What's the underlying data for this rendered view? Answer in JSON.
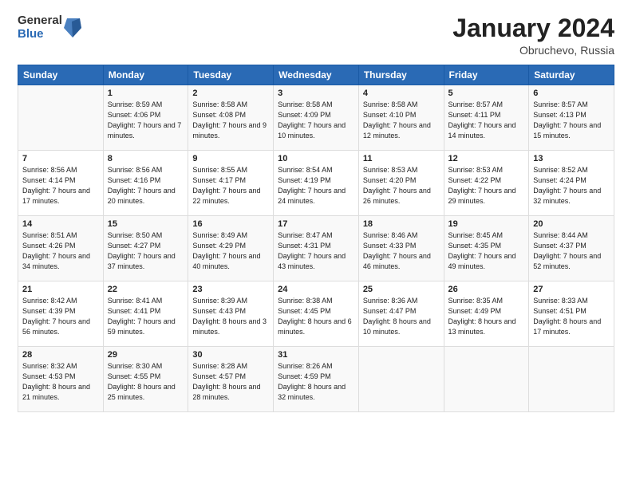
{
  "logo": {
    "general": "General",
    "blue": "Blue"
  },
  "title": "January 2024",
  "location": "Obruchevo, Russia",
  "days_header": [
    "Sunday",
    "Monday",
    "Tuesday",
    "Wednesday",
    "Thursday",
    "Friday",
    "Saturday"
  ],
  "weeks": [
    [
      {
        "day": "",
        "sunrise": "",
        "sunset": "",
        "daylight": ""
      },
      {
        "day": "1",
        "sunrise": "Sunrise: 8:59 AM",
        "sunset": "Sunset: 4:06 PM",
        "daylight": "Daylight: 7 hours and 7 minutes."
      },
      {
        "day": "2",
        "sunrise": "Sunrise: 8:58 AM",
        "sunset": "Sunset: 4:08 PM",
        "daylight": "Daylight: 7 hours and 9 minutes."
      },
      {
        "day": "3",
        "sunrise": "Sunrise: 8:58 AM",
        "sunset": "Sunset: 4:09 PM",
        "daylight": "Daylight: 7 hours and 10 minutes."
      },
      {
        "day": "4",
        "sunrise": "Sunrise: 8:58 AM",
        "sunset": "Sunset: 4:10 PM",
        "daylight": "Daylight: 7 hours and 12 minutes."
      },
      {
        "day": "5",
        "sunrise": "Sunrise: 8:57 AM",
        "sunset": "Sunset: 4:11 PM",
        "daylight": "Daylight: 7 hours and 14 minutes."
      },
      {
        "day": "6",
        "sunrise": "Sunrise: 8:57 AM",
        "sunset": "Sunset: 4:13 PM",
        "daylight": "Daylight: 7 hours and 15 minutes."
      }
    ],
    [
      {
        "day": "7",
        "sunrise": "Sunrise: 8:56 AM",
        "sunset": "Sunset: 4:14 PM",
        "daylight": "Daylight: 7 hours and 17 minutes."
      },
      {
        "day": "8",
        "sunrise": "Sunrise: 8:56 AM",
        "sunset": "Sunset: 4:16 PM",
        "daylight": "Daylight: 7 hours and 20 minutes."
      },
      {
        "day": "9",
        "sunrise": "Sunrise: 8:55 AM",
        "sunset": "Sunset: 4:17 PM",
        "daylight": "Daylight: 7 hours and 22 minutes."
      },
      {
        "day": "10",
        "sunrise": "Sunrise: 8:54 AM",
        "sunset": "Sunset: 4:19 PM",
        "daylight": "Daylight: 7 hours and 24 minutes."
      },
      {
        "day": "11",
        "sunrise": "Sunrise: 8:53 AM",
        "sunset": "Sunset: 4:20 PM",
        "daylight": "Daylight: 7 hours and 26 minutes."
      },
      {
        "day": "12",
        "sunrise": "Sunrise: 8:53 AM",
        "sunset": "Sunset: 4:22 PM",
        "daylight": "Daylight: 7 hours and 29 minutes."
      },
      {
        "day": "13",
        "sunrise": "Sunrise: 8:52 AM",
        "sunset": "Sunset: 4:24 PM",
        "daylight": "Daylight: 7 hours and 32 minutes."
      }
    ],
    [
      {
        "day": "14",
        "sunrise": "Sunrise: 8:51 AM",
        "sunset": "Sunset: 4:26 PM",
        "daylight": "Daylight: 7 hours and 34 minutes."
      },
      {
        "day": "15",
        "sunrise": "Sunrise: 8:50 AM",
        "sunset": "Sunset: 4:27 PM",
        "daylight": "Daylight: 7 hours and 37 minutes."
      },
      {
        "day": "16",
        "sunrise": "Sunrise: 8:49 AM",
        "sunset": "Sunset: 4:29 PM",
        "daylight": "Daylight: 7 hours and 40 minutes."
      },
      {
        "day": "17",
        "sunrise": "Sunrise: 8:47 AM",
        "sunset": "Sunset: 4:31 PM",
        "daylight": "Daylight: 7 hours and 43 minutes."
      },
      {
        "day": "18",
        "sunrise": "Sunrise: 8:46 AM",
        "sunset": "Sunset: 4:33 PM",
        "daylight": "Daylight: 7 hours and 46 minutes."
      },
      {
        "day": "19",
        "sunrise": "Sunrise: 8:45 AM",
        "sunset": "Sunset: 4:35 PM",
        "daylight": "Daylight: 7 hours and 49 minutes."
      },
      {
        "day": "20",
        "sunrise": "Sunrise: 8:44 AM",
        "sunset": "Sunset: 4:37 PM",
        "daylight": "Daylight: 7 hours and 52 minutes."
      }
    ],
    [
      {
        "day": "21",
        "sunrise": "Sunrise: 8:42 AM",
        "sunset": "Sunset: 4:39 PM",
        "daylight": "Daylight: 7 hours and 56 minutes."
      },
      {
        "day": "22",
        "sunrise": "Sunrise: 8:41 AM",
        "sunset": "Sunset: 4:41 PM",
        "daylight": "Daylight: 7 hours and 59 minutes."
      },
      {
        "day": "23",
        "sunrise": "Sunrise: 8:39 AM",
        "sunset": "Sunset: 4:43 PM",
        "daylight": "Daylight: 8 hours and 3 minutes."
      },
      {
        "day": "24",
        "sunrise": "Sunrise: 8:38 AM",
        "sunset": "Sunset: 4:45 PM",
        "daylight": "Daylight: 8 hours and 6 minutes."
      },
      {
        "day": "25",
        "sunrise": "Sunrise: 8:36 AM",
        "sunset": "Sunset: 4:47 PM",
        "daylight": "Daylight: 8 hours and 10 minutes."
      },
      {
        "day": "26",
        "sunrise": "Sunrise: 8:35 AM",
        "sunset": "Sunset: 4:49 PM",
        "daylight": "Daylight: 8 hours and 13 minutes."
      },
      {
        "day": "27",
        "sunrise": "Sunrise: 8:33 AM",
        "sunset": "Sunset: 4:51 PM",
        "daylight": "Daylight: 8 hours and 17 minutes."
      }
    ],
    [
      {
        "day": "28",
        "sunrise": "Sunrise: 8:32 AM",
        "sunset": "Sunset: 4:53 PM",
        "daylight": "Daylight: 8 hours and 21 minutes."
      },
      {
        "day": "29",
        "sunrise": "Sunrise: 8:30 AM",
        "sunset": "Sunset: 4:55 PM",
        "daylight": "Daylight: 8 hours and 25 minutes."
      },
      {
        "day": "30",
        "sunrise": "Sunrise: 8:28 AM",
        "sunset": "Sunset: 4:57 PM",
        "daylight": "Daylight: 8 hours and 28 minutes."
      },
      {
        "day": "31",
        "sunrise": "Sunrise: 8:26 AM",
        "sunset": "Sunset: 4:59 PM",
        "daylight": "Daylight: 8 hours and 32 minutes."
      },
      {
        "day": "",
        "sunrise": "",
        "sunset": "",
        "daylight": ""
      },
      {
        "day": "",
        "sunrise": "",
        "sunset": "",
        "daylight": ""
      },
      {
        "day": "",
        "sunrise": "",
        "sunset": "",
        "daylight": ""
      }
    ]
  ]
}
